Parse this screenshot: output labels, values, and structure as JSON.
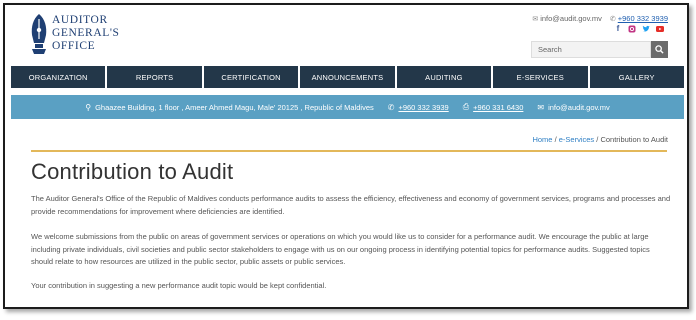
{
  "header": {
    "logo_lines": [
      "Auditor",
      "General's",
      "Office"
    ],
    "email": "info@audit.gov.mv",
    "phone": "+960 332 3939",
    "social_icons": [
      "facebook-icon",
      "instagram-icon",
      "twitter-icon",
      "youtube-icon"
    ],
    "search": {
      "placeholder": "Search"
    }
  },
  "nav": {
    "items": [
      "ORGANIZATION",
      "REPORTS",
      "CERTIFICATION",
      "ANNOUNCEMENTS",
      "AUDITING",
      "E-SERVICES",
      "GALLERY"
    ]
  },
  "infobar": {
    "address": "Ghaazee Building, 1 floor , Ameer Ahmed Magu, Male' 20125 , Republic of Maldives",
    "phone": "+960 332 3939",
    "fax": "+960 331 6430",
    "email": "info@audit.gov.mv"
  },
  "breadcrumb": {
    "home": "Home",
    "sep1": " / ",
    "section": "e-Services",
    "sep2": " / ",
    "current": "Contribution to Audit"
  },
  "main": {
    "title": "Contribution to Audit",
    "paragraphs": [
      "The Auditor General's Office of the Republic of Maldives conducts performance audits to assess the efficiency, effectiveness and economy of government services, programs and processes and provide recommendations for improvement where deficiencies are identified.",
      "We welcome submissions from the public on areas of government services or operations on which you would like us to consider for a performance audit. We encourage the public at large including private individuals, civil societies and public sector stakeholders to engage with us on our ongoing process in identifying potential topics for performance audits. Suggested topics should relate to how resources are utilized in the public sector, public assets or public services.",
      "Your contribution in suggesting a new performance audit topic would be kept confidential."
    ]
  },
  "colors": {
    "nav_bg": "#233749",
    "infobar_bg": "#5aa0c3",
    "accent_rule": "#e3b85a",
    "logo_blue": "#1f3f73",
    "link": "#2f7fc4"
  }
}
